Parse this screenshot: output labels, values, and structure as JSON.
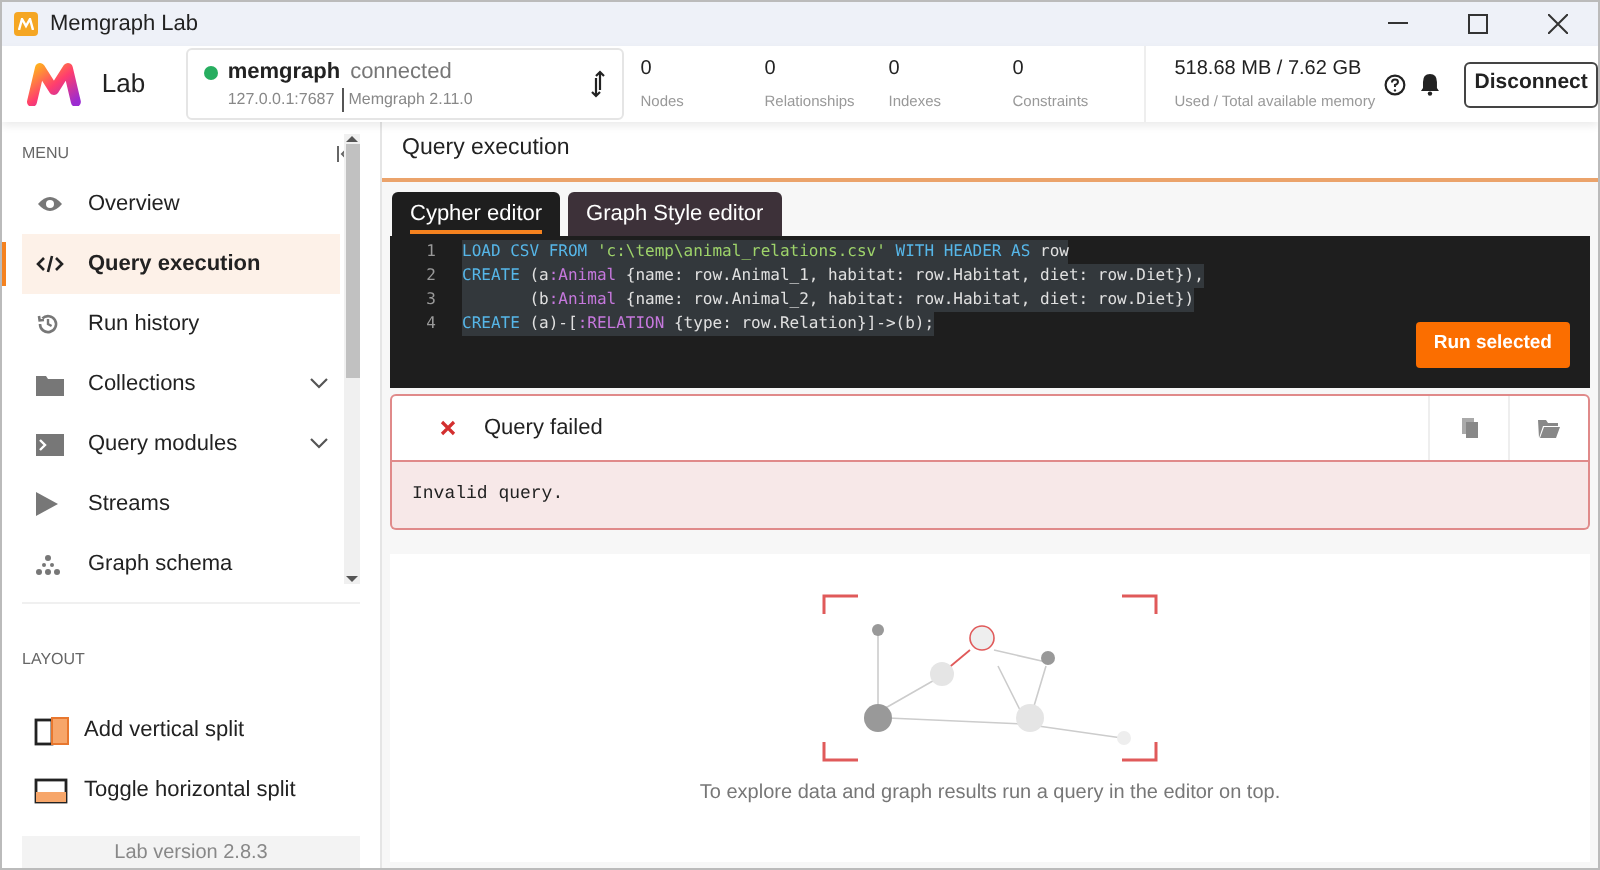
{
  "window": {
    "title": "Memgraph Lab"
  },
  "header": {
    "logo_text": "Lab",
    "connection": {
      "name": "memgraph",
      "status": "connected",
      "online": true,
      "address": "127.0.0.1:7687",
      "version": "Memgraph 2.11.0"
    },
    "stats": [
      {
        "value": "0",
        "label": "Nodes"
      },
      {
        "value": "0",
        "label": "Relationships"
      },
      {
        "value": "0",
        "label": "Indexes"
      },
      {
        "value": "0",
        "label": "Constraints"
      }
    ],
    "memory": {
      "value": "518.68 MB / 7.62 GB",
      "label": "Used / Total available memory"
    },
    "disconnect": "Disconnect"
  },
  "sidebar": {
    "menu_title": "MENU",
    "items": [
      {
        "label": "Overview",
        "selected": false,
        "has_submenu": false
      },
      {
        "label": "Query execution",
        "selected": true,
        "has_submenu": false
      },
      {
        "label": "Run history",
        "selected": false,
        "has_submenu": false
      },
      {
        "label": "Collections",
        "selected": false,
        "has_submenu": true
      },
      {
        "label": "Query modules",
        "selected": false,
        "has_submenu": true
      },
      {
        "label": "Streams",
        "selected": false,
        "has_submenu": false
      },
      {
        "label": "Graph schema",
        "selected": false,
        "has_submenu": false
      }
    ],
    "layout_title": "LAYOUT",
    "layout_items": [
      {
        "label": "Add vertical split"
      },
      {
        "label": "Toggle horizontal split"
      }
    ],
    "version": "Lab version 2.8.3"
  },
  "main": {
    "title": "Query execution",
    "tabs": [
      {
        "label": "Cypher editor",
        "selected": true
      },
      {
        "label": "Graph Style editor",
        "selected": false
      }
    ],
    "code": [
      {
        "number": "1",
        "tokens": [
          {
            "kind": "keyword",
            "text": "LOAD CSV FROM"
          },
          {
            "kind": "string",
            "text": " 'c:\\temp\\animal_relations.csv'"
          },
          {
            "kind": "keyword",
            "text": " WITH HEADER AS"
          },
          {
            "kind": "plain",
            "text": " row"
          }
        ]
      },
      {
        "number": "2",
        "tokens": [
          {
            "kind": "keyword",
            "text": "CREATE"
          },
          {
            "kind": "plain",
            "text": " (a"
          },
          {
            "kind": "label",
            "text": ":Animal"
          },
          {
            "kind": "plain",
            "text": " {name: row.Animal_1, habitat: row.Habitat, diet: row.Diet}),"
          }
        ]
      },
      {
        "number": "3",
        "tokens": [
          {
            "kind": "plain",
            "text": "       (b"
          },
          {
            "kind": "label",
            "text": ":Animal"
          },
          {
            "kind": "plain",
            "text": " {name: row.Animal_2, habitat: row.Habitat, diet: row.Diet})"
          }
        ]
      },
      {
        "number": "4",
        "tokens": [
          {
            "kind": "keyword",
            "text": "CREATE"
          },
          {
            "kind": "plain",
            "text": " (a)-["
          },
          {
            "kind": "label",
            "text": ":RELATION"
          },
          {
            "kind": "plain",
            "text": " {type: row.Relation}]->(b);"
          }
        ]
      }
    ],
    "run_button": "Run selected",
    "result": {
      "status": "Query failed",
      "failed": true,
      "message": "Invalid query."
    },
    "empty_hint": "To explore data and graph results run a query in the editor on top."
  }
}
